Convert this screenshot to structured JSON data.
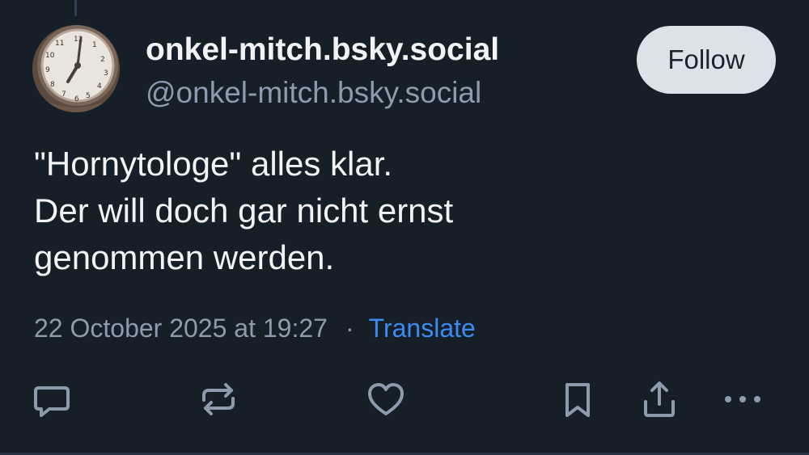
{
  "post": {
    "display_name": "onkel-mitch.bsky.social",
    "handle": "@onkel-mitch.bsky.social",
    "follow_label": "Follow",
    "text_lines": [
      "\"Hornytologe\" alles klar.",
      "Der will doch gar nicht ernst",
      "genommen werden."
    ],
    "timestamp": "22 October 2025 at 19:27",
    "separator": "·",
    "translate_label": "Translate"
  },
  "actions": [
    {
      "icon": "reply-icon"
    },
    {
      "icon": "repost-icon"
    },
    {
      "icon": "like-icon"
    },
    {
      "icon": "bookmark-icon"
    },
    {
      "icon": "share-icon"
    },
    {
      "icon": "more-options-icon"
    }
  ],
  "colors": {
    "background": "#161e27",
    "text_primary": "#f1f3f5",
    "text_muted": "#8d9cac",
    "accent_link": "#3a8cf0",
    "follow_button_bg": "#dce2ea",
    "icon": "#8d9cac"
  }
}
